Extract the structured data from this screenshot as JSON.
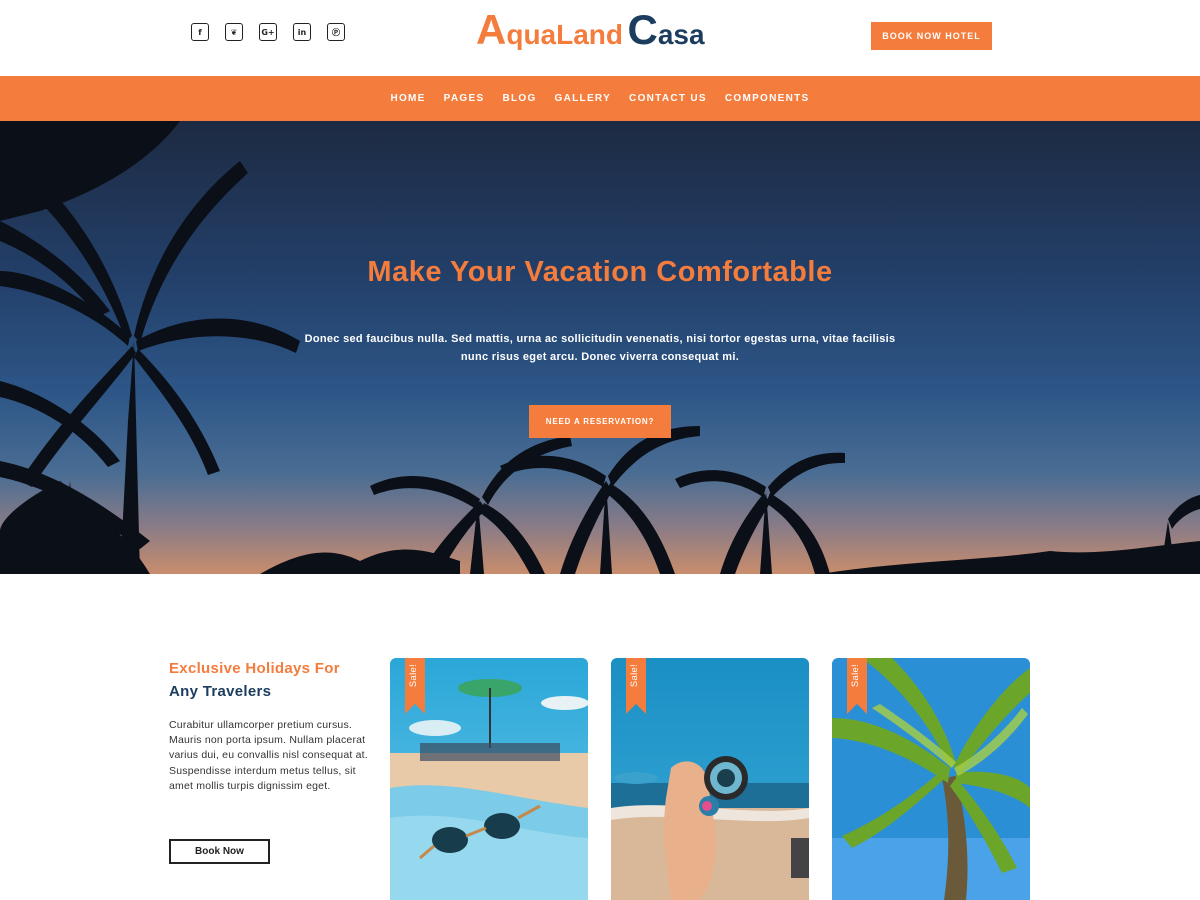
{
  "header": {
    "logo": {
      "part1_cap": "A",
      "part1_rest": "quaLand",
      "part2_cap": "C",
      "part2_rest": "asa"
    },
    "social": [
      {
        "name": "facebook-icon",
        "glyph": "f"
      },
      {
        "name": "twitter-icon",
        "glyph": "❦"
      },
      {
        "name": "google-plus-icon",
        "glyph": "G+"
      },
      {
        "name": "linkedin-icon",
        "glyph": "in"
      },
      {
        "name": "pinterest-icon",
        "glyph": "Ⓟ"
      }
    ],
    "book_button": "BOOK NOW HOTEL"
  },
  "nav": [
    "HOME",
    "PAGES",
    "BLOG",
    "GALLERY",
    "CONTACT US",
    "COMPONENTS"
  ],
  "hero": {
    "title": "Make Your Vacation Comfortable",
    "text": "Donec sed faucibus nulla. Sed mattis, urna ac sollicitudin venenatis, nisi tortor egestas urna, vitae facilisis nunc risus eget arcu. Donec viverra consequat mi.",
    "button": "NEED A RESERVATION?"
  },
  "section": {
    "title_line1": "Exclusive Holidays For",
    "title_line2": "Any Travelers",
    "text": "Curabitur ullamcorper pretium cursus. Mauris non porta ipsum. Nullam placerat varius dui, eu convallis nisl consequat at. Suspendisse interdum metus tellus, sit amet mollis turpis dignissim eget.",
    "button": "Book Now"
  },
  "cards": [
    {
      "badge": "Sale!"
    },
    {
      "badge": "Sale!"
    },
    {
      "badge": "Sale!"
    }
  ],
  "colors": {
    "accent": "#f47c3c",
    "brand_dark": "#1c3d5e"
  }
}
